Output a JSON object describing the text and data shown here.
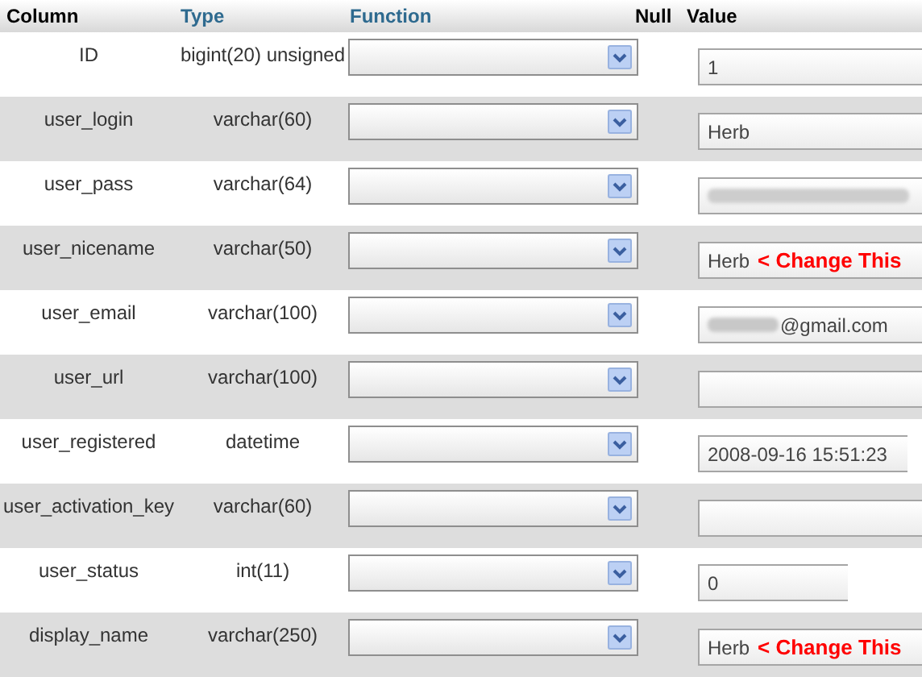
{
  "columns": [
    "Column",
    "Type",
    "Function",
    "Null",
    "Value"
  ],
  "rows": [
    {
      "column": "ID",
      "type": "bigint(20) unsigned",
      "kind": "long",
      "value": "1"
    },
    {
      "column": "user_login",
      "type": "varchar(60)",
      "kind": "long",
      "value": "Herb"
    },
    {
      "column": "user_pass",
      "type": "varchar(64)",
      "kind": "long",
      "blurred_prefix": true
    },
    {
      "column": "user_nicename",
      "type": "varchar(50)",
      "kind": "long",
      "value": "Herb",
      "note": "< Change This"
    },
    {
      "column": "user_email",
      "type": "varchar(100)",
      "kind": "long",
      "value": "@gmail.com",
      "blurred_prefix": true
    },
    {
      "column": "user_url",
      "type": "varchar(100)",
      "kind": "long"
    },
    {
      "column": "user_registered",
      "type": "datetime",
      "kind": "medium",
      "value": "2008-09-16 15:51:23"
    },
    {
      "column": "user_activation_key",
      "type": "varchar(60)",
      "kind": "long"
    },
    {
      "column": "user_status",
      "type": "int(11)",
      "kind": "short",
      "value": "0"
    },
    {
      "column": "display_name",
      "type": "varchar(250)",
      "kind": "long",
      "value": "Herb",
      "note": "< Change This"
    }
  ]
}
